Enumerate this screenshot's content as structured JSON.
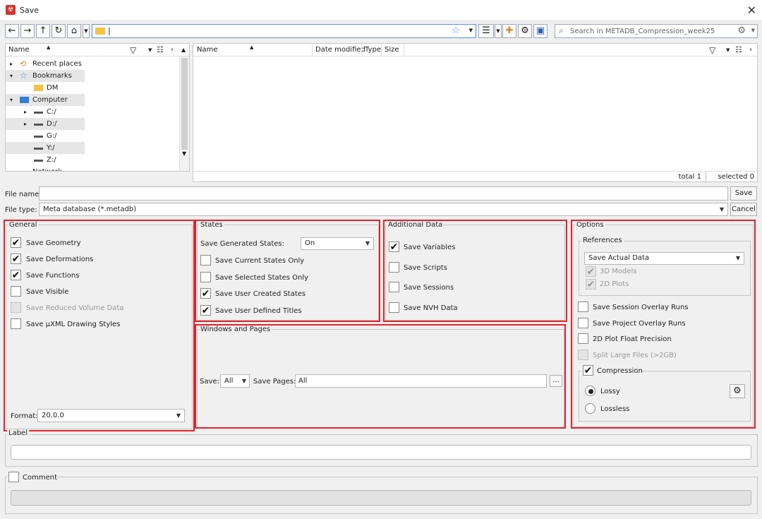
{
  "window": {
    "title": "Save",
    "app_icon_glyph": "☢"
  },
  "toolbar": {
    "back": "←",
    "forward": "→",
    "up": "↑",
    "refresh": "↻",
    "home": "⌂",
    "address_value": "|",
    "search_placeholder": "Search in METADB_Compression_week25"
  },
  "tree": {
    "header": "Name",
    "items": [
      {
        "label": "Recent places",
        "expander": "▸",
        "icon": "recent-places-icon"
      },
      {
        "label": "Bookmarks",
        "expander": "▾",
        "icon": "star-icon"
      },
      {
        "label": "DM",
        "expander": "",
        "icon": "folder-icon"
      },
      {
        "label": "Computer",
        "expander": "▾",
        "icon": "computer-icon"
      },
      {
        "label": "C:/",
        "expander": "▸",
        "icon": "drive-icon"
      },
      {
        "label": "D:/",
        "expander": "▸",
        "icon": "drive-icon"
      },
      {
        "label": "G:/",
        "expander": "",
        "icon": "drive-icon"
      },
      {
        "label": "Y:/",
        "expander": "",
        "icon": "drive-icon"
      },
      {
        "label": "Z:/",
        "expander": "",
        "icon": "drive-icon"
      },
      {
        "label": "Network places",
        "expander": "",
        "icon": "network-icon"
      }
    ]
  },
  "files": {
    "columns": [
      "Name",
      "Date modified",
      "Type",
      "Size"
    ],
    "total": "total 1",
    "selected": "selected 0"
  },
  "file_name": {
    "label": "File name:",
    "value": "",
    "save_button": "Save"
  },
  "file_type": {
    "label": "File type:",
    "value": "Meta database (*.metadb)",
    "cancel_button": "Cancel"
  },
  "general": {
    "title": "General",
    "items": [
      {
        "label": "Save Geometry",
        "checked": "✔",
        "disabled": false
      },
      {
        "label": "Save Deformations",
        "checked": "✔",
        "disabled": false
      },
      {
        "label": "Save Functions",
        "checked": "✔",
        "disabled": false
      },
      {
        "label": "Save Visible",
        "checked": "",
        "disabled": false
      },
      {
        "label": "Save Reduced Volume Data",
        "checked": "",
        "disabled": true
      },
      {
        "label": "Save µXML Drawing Styles",
        "checked": "",
        "disabled": false
      }
    ],
    "format_label": "Format:",
    "format_value": "20.0.0"
  },
  "states": {
    "title": "States",
    "generated_label": "Save Generated States:",
    "generated_value": "On",
    "items": [
      {
        "label": "Save Current States Only",
        "checked": ""
      },
      {
        "label": "Save Selected States Only",
        "checked": ""
      },
      {
        "label": "Save User Created States",
        "checked": "✔"
      },
      {
        "label": "Save User Defined Titles",
        "checked": "✔"
      }
    ]
  },
  "additional": {
    "title": "Additional Data",
    "items": [
      {
        "label": "Save Variables",
        "checked": "✔"
      },
      {
        "label": "Save Scripts",
        "checked": ""
      },
      {
        "label": "Save Sessions",
        "checked": ""
      },
      {
        "label": "Save NVH Data",
        "checked": ""
      }
    ]
  },
  "windows": {
    "title": "Windows and Pages",
    "save_label": "Save:",
    "save_value": "All",
    "pages_label": "Save Pages:",
    "pages_value": "All",
    "browse": "..."
  },
  "options": {
    "title": "Options",
    "references_title": "References",
    "references_value": "Save Actual Data",
    "models_label": "3D Models",
    "plots_label": "2D Plots",
    "check_glyph": "✔",
    "items": [
      {
        "label": "Save Session Overlay Runs",
        "checked": ""
      },
      {
        "label": "Save Project Overlay Runs",
        "checked": ""
      },
      {
        "label": "2D Plot Float Precision",
        "checked": ""
      },
      {
        "label": "Split Large Files (>2GB)",
        "checked": ""
      }
    ],
    "compression_label": "Compression",
    "compression_checked": "✔",
    "lossy": "Lossy",
    "lossless": "Lossless"
  },
  "label_section": {
    "title": "Label",
    "value": ""
  },
  "comment_section": {
    "title": "Comment",
    "value": ""
  },
  "colors": {
    "highlight": "#e0242c",
    "address_border": "#5b8fd6"
  }
}
